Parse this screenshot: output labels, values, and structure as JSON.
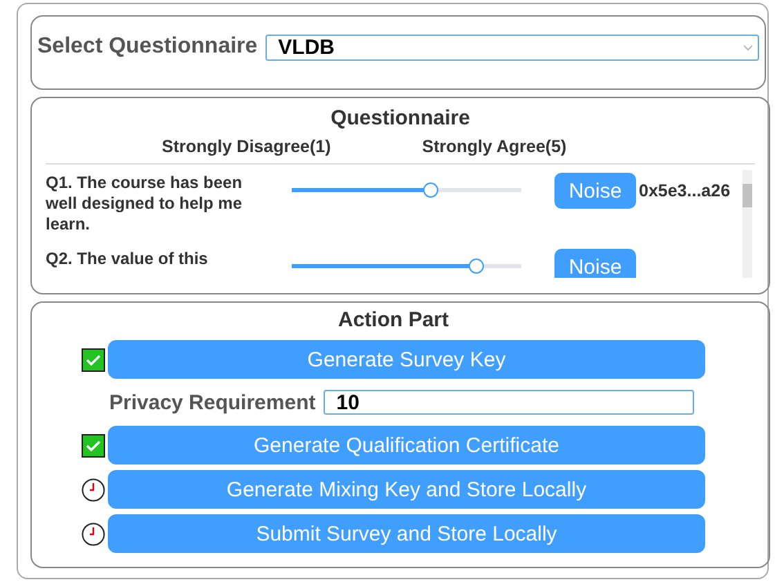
{
  "selector": {
    "label": "Select Questionnaire",
    "value": "VLDB"
  },
  "questionnaire": {
    "title": "Questionnaire",
    "scale_low": "Strongly Disagree(1)",
    "scale_high": "Strongly Agree(5)",
    "questions": [
      {
        "text": "Q1. The course has been well designed to help me learn.",
        "level": 0.6,
        "button": "Noise",
        "hash": "0x5e3...a26"
      },
      {
        "text": "Q2. The value of this",
        "level": 0.8,
        "button": "Noise"
      }
    ]
  },
  "actions": {
    "title": "Action Part",
    "items": [
      {
        "kind": "button",
        "completed": true,
        "label": "Generate Survey Key"
      },
      {
        "kind": "field",
        "label": "Privacy Requirement",
        "value": "10"
      },
      {
        "kind": "button",
        "completed": true,
        "label": "Generate Qualification Certificate"
      },
      {
        "kind": "button",
        "completed": false,
        "label": "Generate Mixing Key and Store Locally"
      },
      {
        "kind": "button",
        "completed": false,
        "label": "Submit Survey and Store Locally"
      }
    ]
  }
}
